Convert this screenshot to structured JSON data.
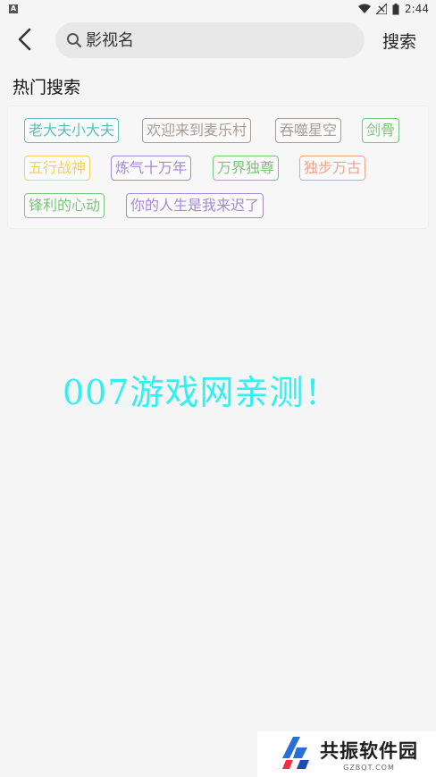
{
  "status_bar": {
    "left_badge": "A",
    "time": "2:44",
    "icons": [
      "wifi-icon",
      "signal-icon",
      "battery-icon"
    ]
  },
  "header": {
    "back_icon": "chevron-left-icon",
    "search_icon": "search-icon",
    "search_value": "影视名",
    "search_button_label": "搜索"
  },
  "hot_search": {
    "title": "热门搜索",
    "tags": [
      {
        "label": "老大夫小大夫",
        "color": "#5bbfc0"
      },
      {
        "label": "欢迎来到麦乐村",
        "color": "#a89c95"
      },
      {
        "label": "吞噬星空",
        "color": "#a89c95"
      },
      {
        "label": "剑骨",
        "color": "#7cc47c"
      },
      {
        "label": "五行战神",
        "color": "#f3d35a"
      },
      {
        "label": "炼气十万年",
        "color": "#a48bd3"
      },
      {
        "label": "万界独尊",
        "color": "#7cc47c"
      },
      {
        "label": "独步万古",
        "color": "#f2a48a"
      },
      {
        "label": "锋利的心动",
        "color": "#7cc47c"
      },
      {
        "label": "你的人生是我来迟了",
        "color": "#a48bd3"
      }
    ]
  },
  "overlay": {
    "text": "007游戏网亲测！",
    "color": "#33f0f0"
  },
  "logo": {
    "name": "共振软件园",
    "domain": "GZBQT.COM"
  }
}
